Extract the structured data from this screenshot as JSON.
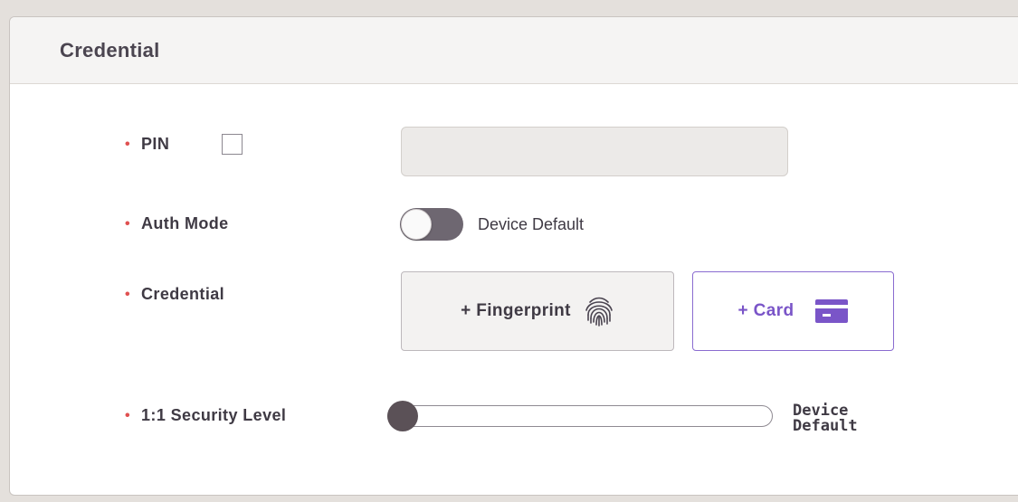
{
  "panel": {
    "title": "Credential"
  },
  "pin": {
    "label": "PIN",
    "checked": false,
    "value": ""
  },
  "auth_mode": {
    "label": "Auth Mode",
    "toggle_on": false,
    "value_text": "Device Default"
  },
  "credential": {
    "label": "Credential",
    "fingerprint_button": "+ Fingerprint",
    "card_button": "+ Card"
  },
  "security_level": {
    "label": "1:1 Security Level",
    "value_line1": "Device",
    "value_line2": "Default",
    "slider_position": 0
  },
  "colors": {
    "required_marker": "#e05050",
    "card_accent": "#7a55c8",
    "toggle_off": "#6e6771",
    "slider_thumb": "#5b5157"
  },
  "icons": {
    "fingerprint": "fingerprint-icon",
    "card": "card-icon"
  }
}
